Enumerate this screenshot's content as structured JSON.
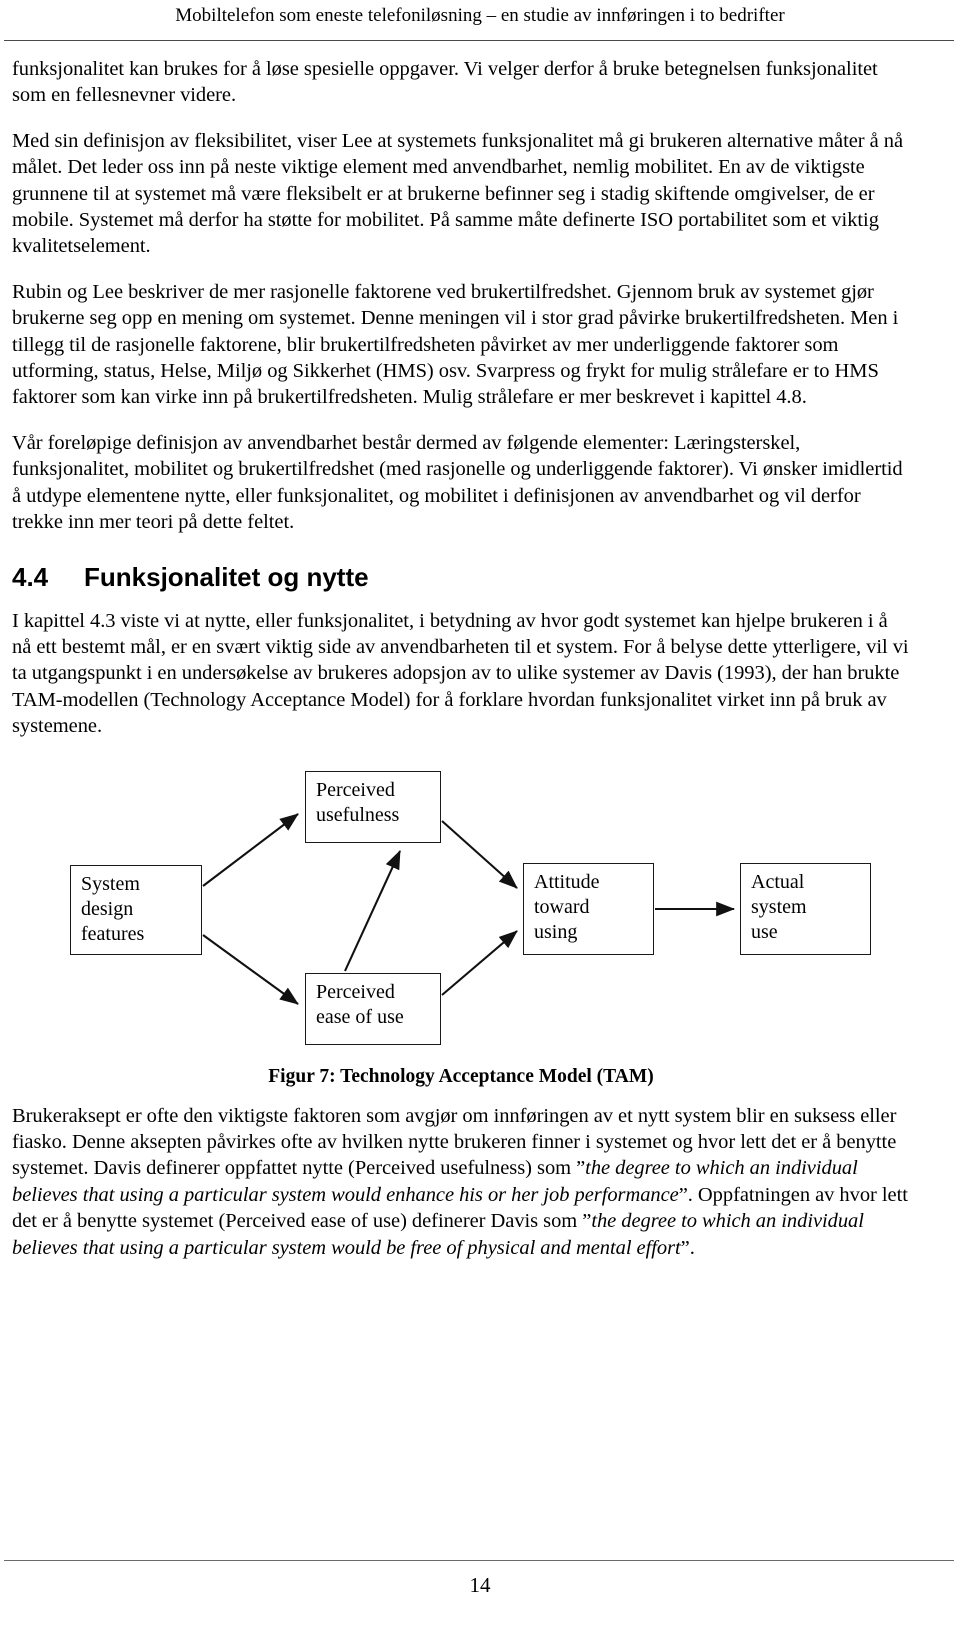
{
  "header": {
    "title": "Mobiltelefon som eneste telefoniløsning – en studie av innføringen i to bedrifter"
  },
  "body": {
    "paragraph_1": "funksjonalitet kan brukes for å løse spesielle oppgaver. Vi velger derfor å bruke betegnelsen funksjonalitet som en fellesnevner videre.",
    "paragraph_2": "Med sin definisjon av fleksibilitet, viser Lee at systemets funksjonalitet må gi brukeren alternative måter å nå målet. Det leder oss inn på neste viktige element med anvendbarhet, nemlig mobilitet. En av de viktigste grunnene til at systemet må være fleksibelt er at brukerne befinner seg i stadig skiftende omgivelser, de er mobile. Systemet må derfor ha støtte for mobilitet. På samme måte definerte ISO portabilitet som et viktig kvalitetselement.",
    "paragraph_3": "Rubin og Lee beskriver de mer rasjonelle faktorene ved brukertilfredshet. Gjennom bruk av systemet gjør brukerne seg opp en mening om systemet. Denne meningen vil i stor grad påvirke brukertilfredsheten. Men i tillegg til de rasjonelle faktorene, blir brukertilfredsheten påvirket av mer underliggende faktorer som utforming, status, Helse, Miljø og Sikkerhet (HMS) osv. Svarpress og frykt for mulig strålefare er to HMS faktorer som kan virke inn på brukertilfredsheten. Mulig strålefare er mer beskrevet i kapittel 4.8.",
    "paragraph_4": "Vår foreløpige definisjon av anvendbarhet består dermed av følgende elementer: Læringsterskel, funksjonalitet, mobilitet og brukertilfredshet (med rasjonelle og underliggende faktorer). Vi ønsker imidlertid å utdype elementene nytte, eller funksjonalitet, og mobilitet i definisjonen av anvendbarhet og vil derfor trekke inn mer teori på dette feltet.",
    "paragraph_5": "I kapittel 4.3 viste vi at nytte, eller funksjonalitet, i betydning av hvor godt systemet kan hjelpe brukeren i å nå ett bestemt mål, er en svært viktig side av anvendbarheten til et system. For å belyse dette ytterligere, vil vi ta utgangspunkt i en undersøkelse av brukeres adopsjon av to ulike systemer av Davis (1993), der han brukte TAM-modellen (Technology Acceptance Model) for å forklare hvordan funksjonalitet virket inn på bruk av systemene.",
    "paragraph_6_part_1": "Brukeraksept er ofte den viktigste faktoren som avgjør om innføringen av et nytt system blir en suksess eller fiasko. Denne aksepten påvirkes ofte av hvilken nytte brukeren finner i systemet og hvor lett det er å benytte systemet. Davis definerer oppfattet nytte (Perceived usefulness) som ”",
    "paragraph_6_quote_1": "the degree to which an individual believes that using a particular system would enhance his or her job performance",
    "paragraph_6_part_2": "”. Oppfatningen av hvor lett det er å benytte systemet (Perceived ease of use) definerer Davis som ”",
    "paragraph_6_quote_2": "the degree to which an individual believes that using a particular system would be free of physical and mental effort",
    "paragraph_6_part_3": "”."
  },
  "section": {
    "number": "4.4",
    "title": "Funksjonalitet og nytte"
  },
  "figure": {
    "caption": "Figur 7: Technology Acceptance Model (TAM)",
    "boxes": {
      "perceived_usefulness": "Perceived\nusefulness",
      "system_design_features": "System\ndesign\nfeatures",
      "attitude_toward_using": "Attitude\ntoward\nusing",
      "actual_system_use": "Actual\nsystem\nuse",
      "perceived_ease_of_use": "Perceived\nease of use"
    },
    "edges": [
      "System design features -> Perceived usefulness",
      "System design features -> Perceived ease of use",
      "Perceived ease of use -> Perceived usefulness",
      "Perceived usefulness -> Attitude toward using",
      "Perceived ease of use -> Attitude toward using",
      "Attitude toward using -> Actual system use"
    ]
  },
  "footer": {
    "page_number": "14"
  },
  "colors": {
    "text": "#000000",
    "rule": "#4a4a4a",
    "box_border": "#1a1a1a",
    "background": "#ffffff"
  }
}
